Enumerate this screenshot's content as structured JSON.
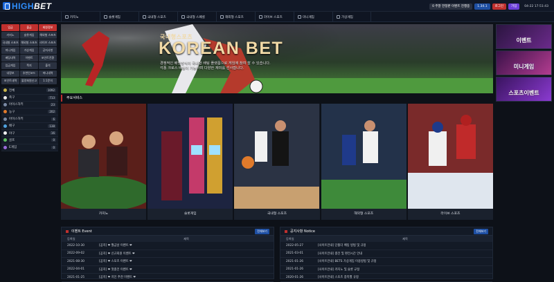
{
  "brand": {
    "name_a": "HIGH",
    "name_b": "BET"
  },
  "topbar": {
    "notice": "0 주말 한정판 이벤트 진행중",
    "balance": "1.34.1",
    "login": "로그인",
    "signup": "가입",
    "clock": "04-22 17:51:43",
    "colors": {
      "login": "#c0302e",
      "signup": "#6b3fd9",
      "balance": "#1e4fa3"
    }
  },
  "nav": [
    "카지노",
    "슬롯게임",
    "국내형 스포츠",
    "국내형 스페셜",
    "해외형 스포츠",
    "라이브 스포츠",
    "미니게임",
    "가상게임"
  ],
  "side_buttons": [
    "입금",
    "출금",
    "회원정보",
    "카지노",
    "슬롯게임",
    "해외형 스포츠",
    "국내형 스포츠",
    "해외형 스포츠",
    "라이브 스포츠",
    "미니게임",
    "가상게임",
    "공지사항",
    "베팅내역",
    "이벤트",
    "포인트전환",
    "입금게임",
    "쪽지",
    "출석",
    "내정보",
    "추천인코드",
    "머니내역",
    "포인트내역",
    "불량회원신고",
    "1:1문의"
  ],
  "sports": [
    {
      "name": "전체",
      "count": "1092"
    },
    {
      "name": "축구",
      "count": "713"
    },
    {
      "name": "아이스하키",
      "count": "23"
    },
    {
      "name": "농구",
      "count": "202"
    },
    {
      "name": "아이스하키",
      "count": "6"
    },
    {
      "name": "배구",
      "count": "138"
    },
    {
      "name": "야구",
      "count": "16"
    },
    {
      "name": "골프",
      "count": "0"
    },
    {
      "name": "E게임",
      "count": "0"
    }
  ],
  "hero": {
    "subtitle": "국내형스포츠",
    "title": "KOREAN BET",
    "desc1": "경쟁적인 배당방식의 국내형 배팅 플랫폼으로 게임에 참여 할 수 있습니다.",
    "desc2": "각종 크로스 배팅이 가능하며 다양한 재미를 선사합니다."
  },
  "banners": [
    "이벤트",
    "미니게임",
    "스포츠이벤트"
  ],
  "section_title": "주요서비스",
  "games": [
    "카지노",
    "슬롯게임",
    "국내형 스포츠",
    "해외형 스포츠",
    "라이브 스포츠"
  ],
  "events": {
    "title": "이벤트 Event",
    "more": "전체보기",
    "col_date": "등록일",
    "col_title": "제목",
    "rows": [
      {
        "date": "2022-10-30",
        "title": "[공지] ❤ 월급날 이벤트 ❤"
      },
      {
        "date": "2022-09-02",
        "title": "[공지] ❤ 신규회원 이벤트 ❤"
      },
      {
        "date": "2021-08-30",
        "title": "[공지] ❤ 스포츠 이벤트 ❤"
      },
      {
        "date": "2022-04-01",
        "title": "[공지] ❤ 첫충전 이벤트 ❤"
      },
      {
        "date": "2021-01-25",
        "title": "[공지] ❤ 지인 추천 이벤트 ❤"
      }
    ]
  },
  "notices": {
    "title": "공지사항 Notice",
    "more": "전체보기",
    "col_date": "등록일",
    "col_title": "제목",
    "rows": [
      {
        "date": "2022-05-27",
        "title": "[사이트안내] 단폴더 배팅 방법 및 규정"
      },
      {
        "date": "2021-03-01",
        "title": "[사이트안내] 충전 및 환전시간 안내"
      },
      {
        "date": "2021-01-26",
        "title": "[사이트안내] BETS 가상게임 이용방법 및 규정"
      },
      {
        "date": "2021-01-26",
        "title": "[사이트안내] 카지노 및 슬롯 규정"
      },
      {
        "date": "2020-01-26",
        "title": "[사이트안내] 스포츠 종목별 규정"
      }
    ]
  }
}
